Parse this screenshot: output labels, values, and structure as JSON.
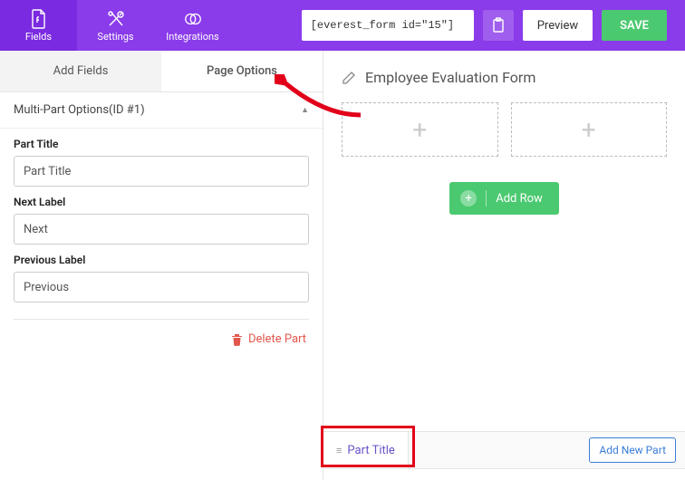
{
  "topbar": {
    "nav": {
      "fields": "Fields",
      "settings": "Settings",
      "integrations": "Integrations"
    },
    "shortcode": "[everest_form id=\"15\"]",
    "preview": "Preview",
    "save": "SAVE"
  },
  "sidebar": {
    "tabs": {
      "add_fields": "Add Fields",
      "page_options": "Page Options"
    },
    "section_title": "Multi-Part Options(ID #1)",
    "part_title": {
      "label": "Part Title",
      "value": "Part Title"
    },
    "next_label": {
      "label": "Next Label",
      "value": "Next"
    },
    "previous_label": {
      "label": "Previous Label",
      "value": "Previous"
    },
    "delete_part": "Delete Part"
  },
  "canvas": {
    "form_title": "Employee Evaluation Form",
    "add_row": "Add Row"
  },
  "bottom": {
    "part_tab": "Part Title",
    "add_new_part": "Add New Part"
  }
}
